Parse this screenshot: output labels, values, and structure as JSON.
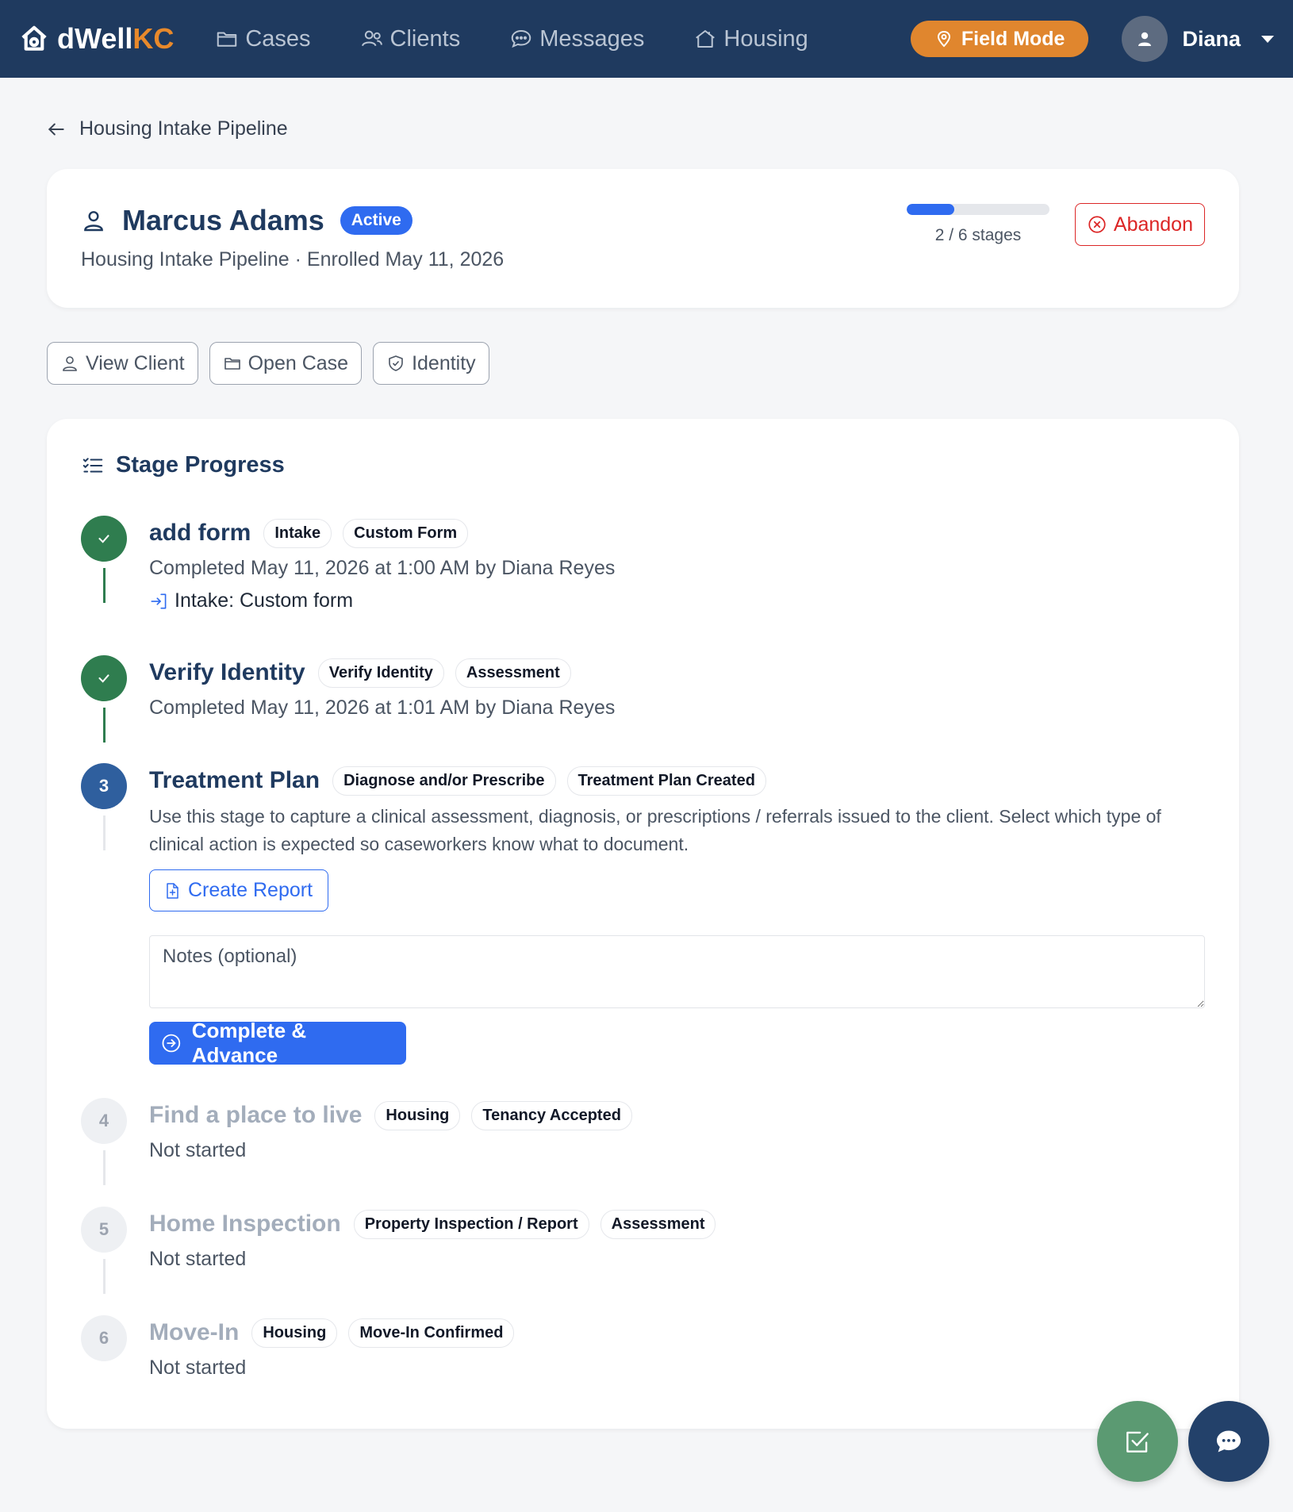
{
  "nav": {
    "brand_main": "dWell",
    "brand_accent": "KC",
    "links": [
      {
        "label": "Cases",
        "icon": "folder-icon"
      },
      {
        "label": "Clients",
        "icon": "users-icon"
      },
      {
        "label": "Messages",
        "icon": "chat-bubble-icon"
      },
      {
        "label": "Housing",
        "icon": "house-icon"
      }
    ],
    "field_mode_label": "Field Mode",
    "user_name": "Diana"
  },
  "breadcrumb": {
    "label": "Housing Intake Pipeline"
  },
  "header": {
    "client_name": "Marcus Adams",
    "status": "Active",
    "subtitle": "Housing Intake Pipeline · Enrolled May 11, 2026",
    "progress_completed": 2,
    "progress_total": 6,
    "progress_text": "2 / 6 stages",
    "abandon_label": "Abandon"
  },
  "actions": {
    "view_client": "View Client",
    "open_case": "Open Case",
    "identity": "Identity"
  },
  "stages": {
    "title": "Stage Progress",
    "items": [
      {
        "name": "add form",
        "tags": [
          "Intake",
          "Custom Form"
        ],
        "meta": "Completed May 11, 2026 at 1:00 AM by Diana Reyes",
        "link": "Intake: Custom form"
      },
      {
        "name": "Verify Identity",
        "tags": [
          "Verify Identity",
          "Assessment"
        ],
        "meta": "Completed May 11, 2026 at 1:01 AM by Diana Reyes"
      },
      {
        "number": "3",
        "name": "Treatment Plan",
        "tags": [
          "Diagnose and/or Prescribe",
          "Treatment Plan Created"
        ],
        "description": "Use this stage to capture a clinical assessment, diagnosis, or prescriptions / referrals issued to the client. Select which type of clinical action is expected so caseworkers know what to document.",
        "create_report_label": "Create Report",
        "notes_placeholder": "Notes (optional)",
        "complete_label": "Complete & Advance"
      },
      {
        "number": "4",
        "name": "Find a place to live",
        "tags": [
          "Housing",
          "Tenancy Accepted"
        ],
        "meta": "Not started"
      },
      {
        "number": "5",
        "name": "Home Inspection",
        "tags": [
          "Property Inspection / Report",
          "Assessment"
        ],
        "meta": "Not started"
      },
      {
        "number": "6",
        "name": "Move-In",
        "tags": [
          "Housing",
          "Move-In Confirmed"
        ],
        "meta": "Not started"
      }
    ]
  },
  "colors": {
    "nav_bg": "#1f3a5f",
    "accent_orange": "#e0862e",
    "primary_blue": "#2f6bf0",
    "done_green": "#2f7d4f",
    "danger_red": "#dc2626"
  }
}
